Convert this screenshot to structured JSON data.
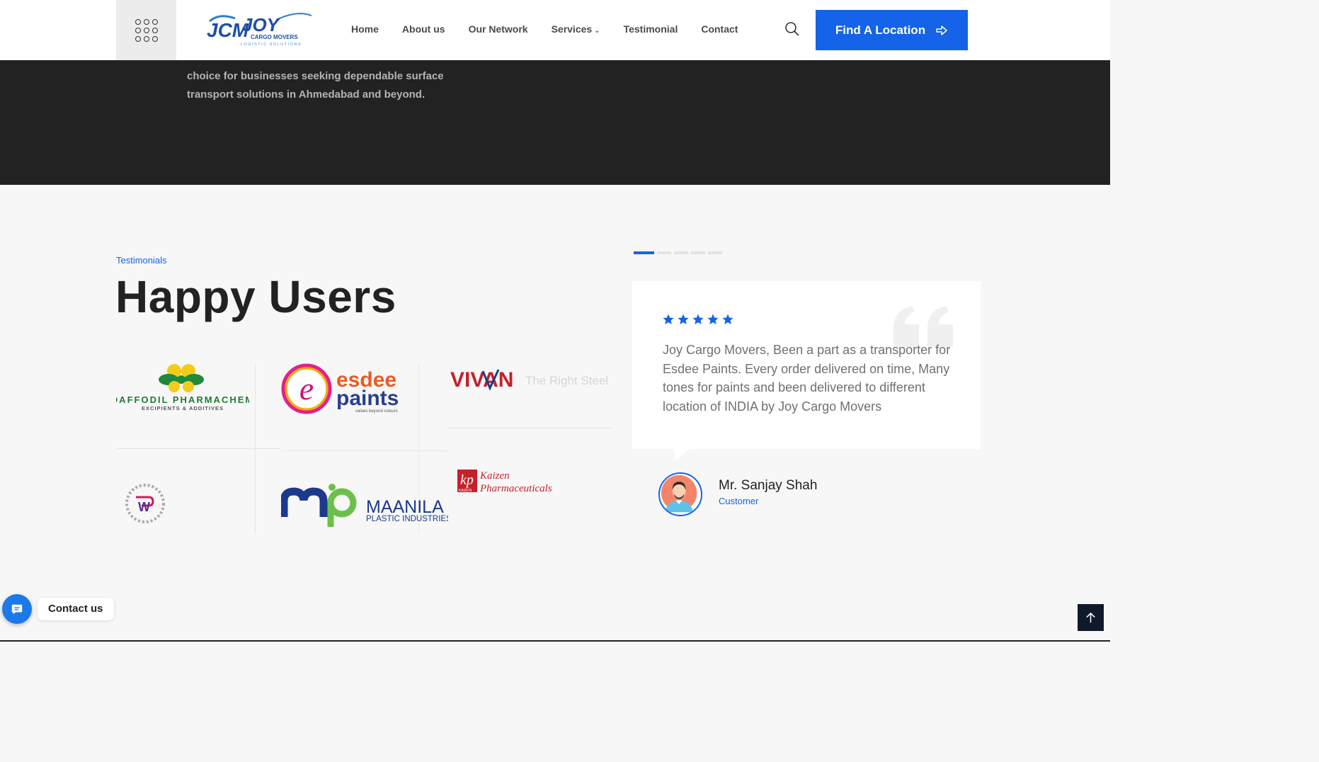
{
  "header": {
    "logo_text": "JOY",
    "logo_monogram": "JCM",
    "logo_sub1": "CARGO MOVERS",
    "logo_sub2": "LOGISTIC SOLUTIONS",
    "menu_icon": "grid-dots-icon",
    "nav": [
      {
        "label": "Home"
      },
      {
        "label": "About us"
      },
      {
        "label": "Our Network"
      },
      {
        "label": "Services",
        "has_dropdown": true
      },
      {
        "label": "Testimonial"
      },
      {
        "label": "Contact"
      }
    ],
    "search_icon": "search-icon",
    "cta_label": "Find A Location",
    "cta_icon": "arrow-right-circle-icon",
    "cta_color": "#1463e8"
  },
  "about": {
    "text": "choice for businesses seeking dependable surface transport solutions in Ahmedabad and beyond."
  },
  "testimonials": {
    "tag": "Testimonials",
    "heading": "Happy Users",
    "clients": [
      {
        "name": "DAFFODIL PHARMACHEM",
        "tagline": "EXCIPIENTS & ADDITIVES"
      },
      {
        "name": "esdee",
        "name2": "paints",
        "tagline": "values beyond colours"
      },
      {
        "name": "VIVAN",
        "tagline": "The Right Steel"
      },
      {
        "name": "W",
        "tagline": ""
      },
      {
        "name": "MAANILA",
        "tagline": "PLASTIC INDUSTRIES"
      },
      {
        "name": "Kaizen",
        "name2": "Pharmaceuticals",
        "tagline": "KAIZEN"
      }
    ],
    "slides_count": 5,
    "active_slide": 1,
    "rating": 5,
    "quote": "Joy Cargo Movers, Been a part as a transporter for Esdee Paints. Every order delivered on time, Many tones for paints and been delivered to different location of INDIA by Joy Cargo Movers",
    "author": "Mr. Sanjay Shah",
    "role": "Customer"
  },
  "floating": {
    "contact_label": "Contact us",
    "contact_icon": "chat-bubble-icon",
    "back_to_top_icon": "arrow-up-icon"
  }
}
